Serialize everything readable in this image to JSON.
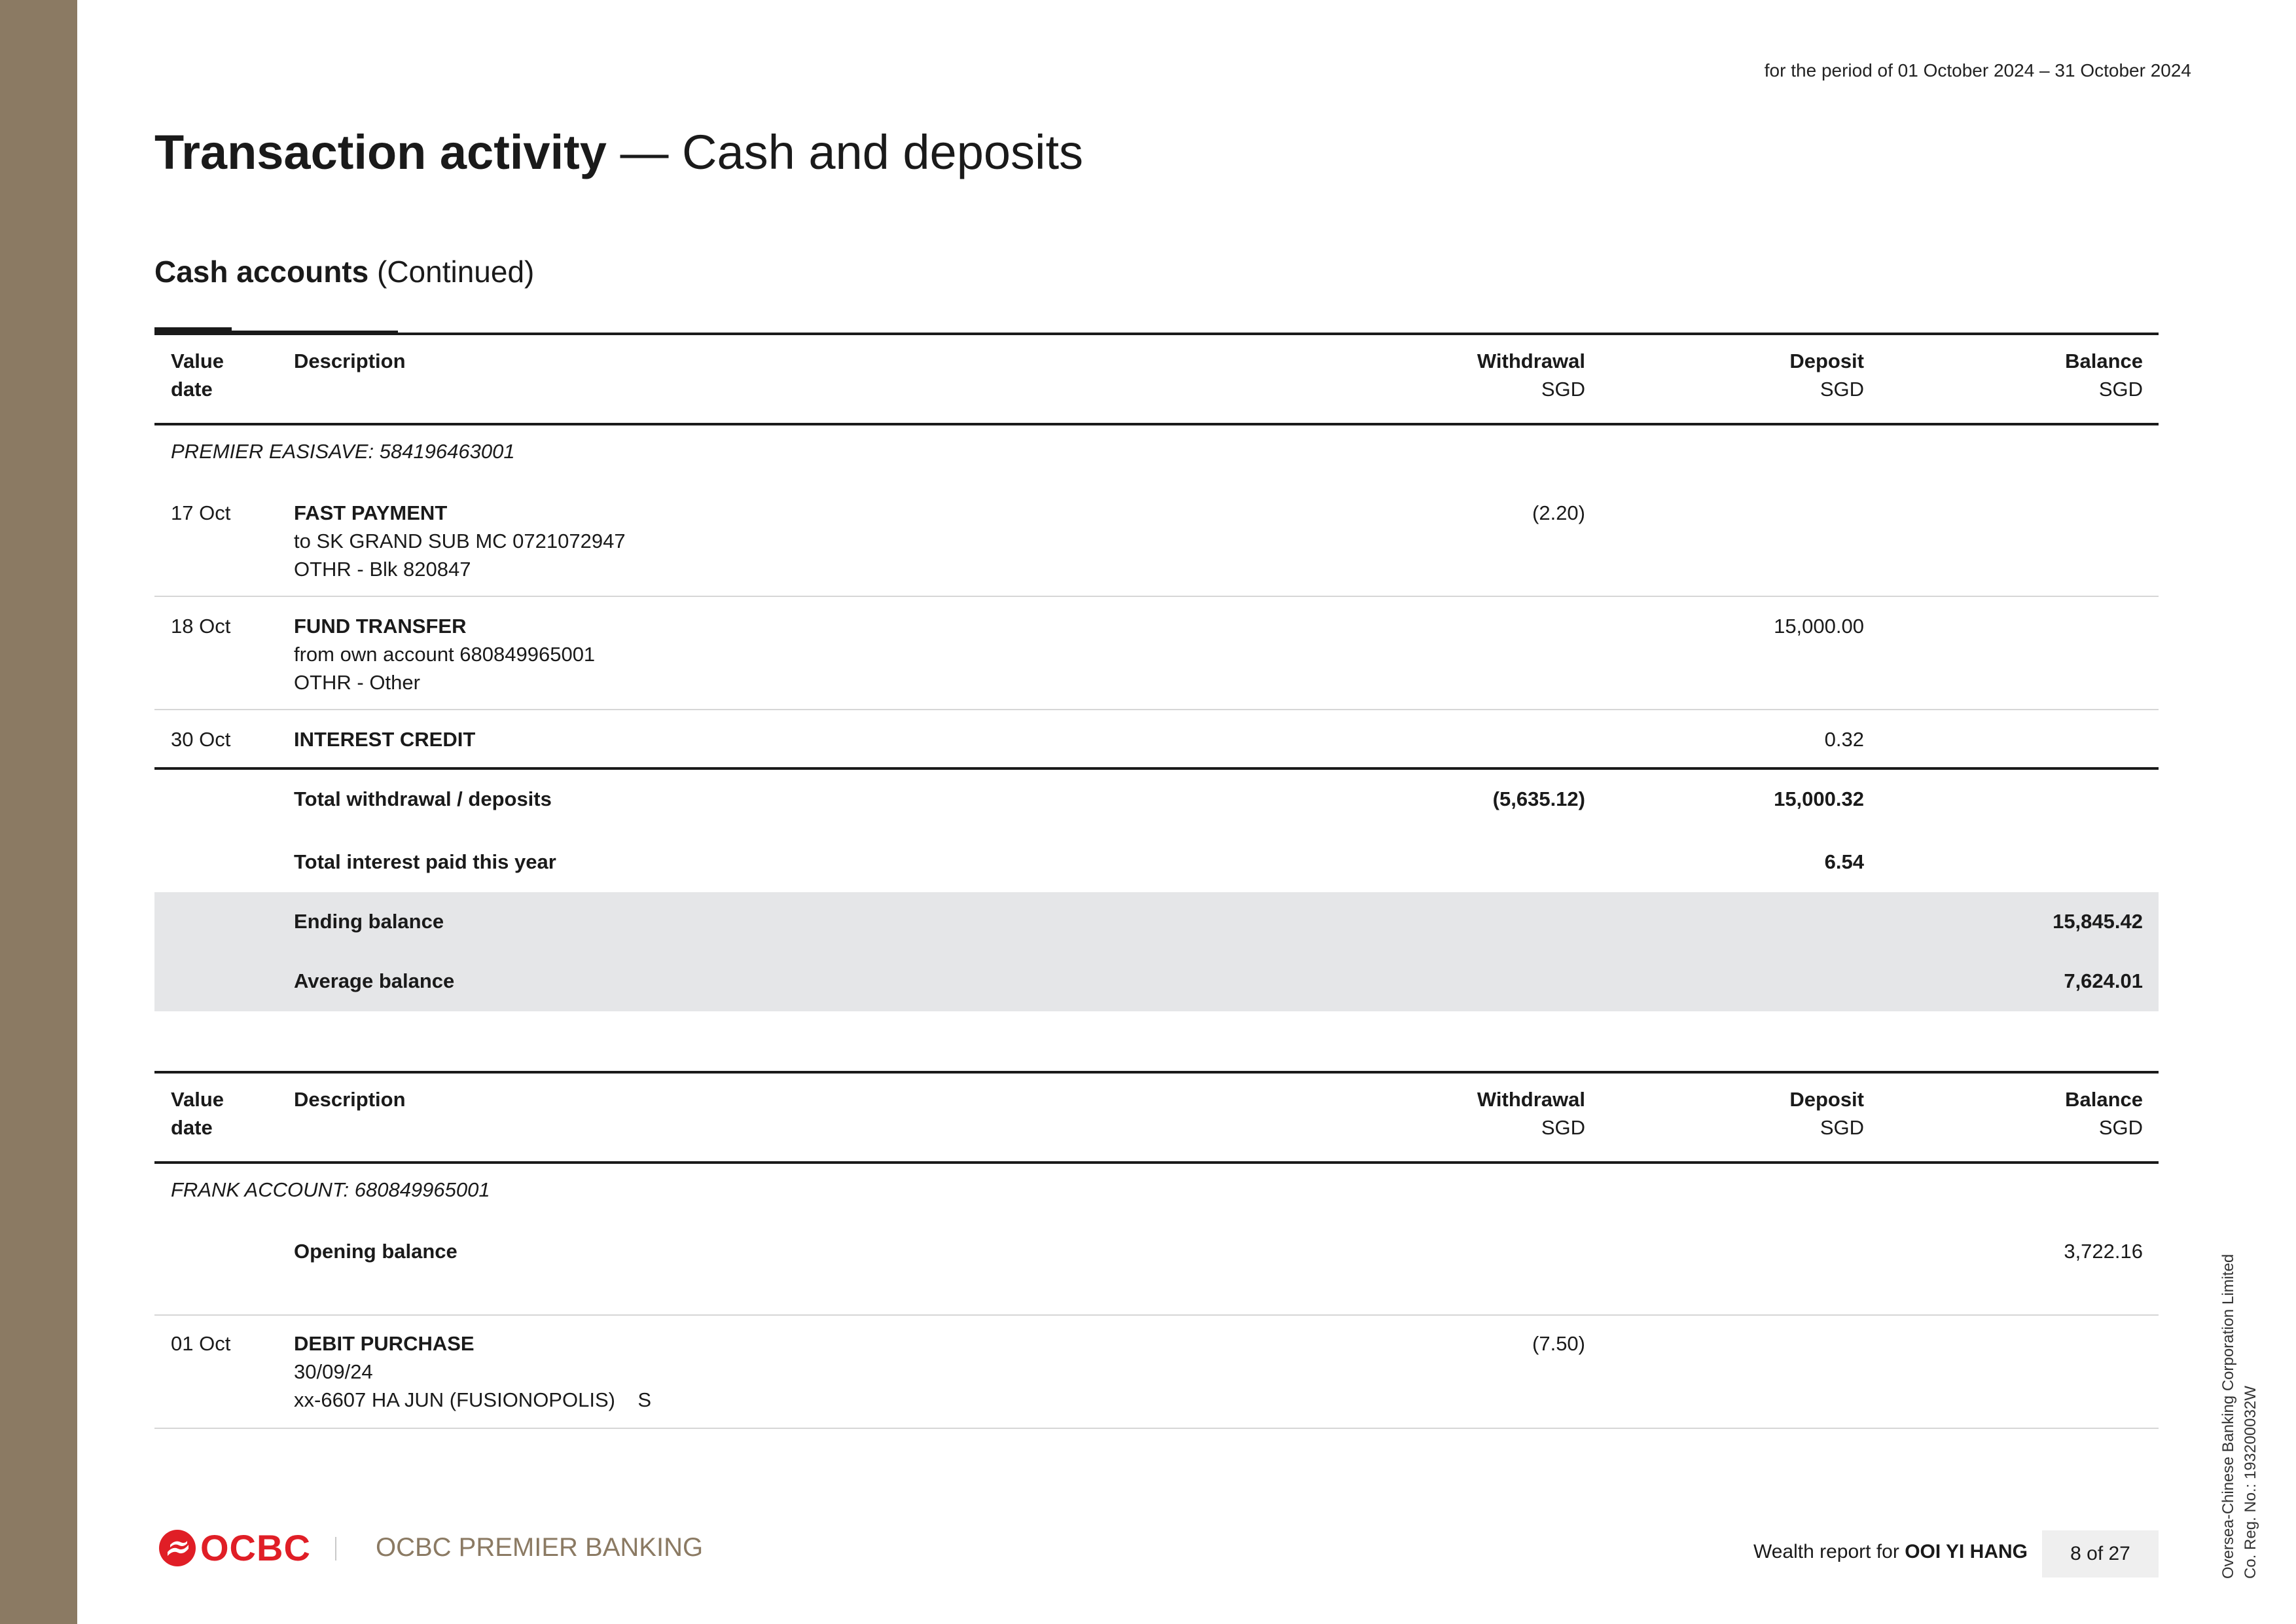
{
  "header": {
    "period": "for the period of 01 October 2024 – 31 October 2024",
    "title_bold": "Transaction activity",
    "title_rest": " — Cash and deposits",
    "section_bold": "Cash accounts",
    "section_rest": " (Continued)"
  },
  "columns": {
    "value_date_1": "Value",
    "value_date_2": "date",
    "description": "Description",
    "withdrawal": "Withdrawal",
    "deposit": "Deposit",
    "balance": "Balance",
    "unit": "SGD"
  },
  "table1": {
    "account": "PREMIER EASISAVE: 584196463001",
    "rows": [
      {
        "date": "17 Oct",
        "title": "FAST PAYMENT",
        "line2": "to SK GRAND SUB MC 0721072947",
        "line3": "OTHR - Blk 820847",
        "withdrawal": "(2.20)",
        "deposit": ""
      },
      {
        "date": "18 Oct",
        "title": "FUND TRANSFER",
        "line2": "from own account 680849965001",
        "line3": "OTHR - Other",
        "withdrawal": "",
        "deposit": "15,000.00"
      },
      {
        "date": "30 Oct",
        "title": "INTEREST CREDIT",
        "withdrawal": "",
        "deposit": "0.32"
      }
    ],
    "totals": {
      "total_label": "Total withdrawal / deposits",
      "total_withdrawal": "(5,635.12)",
      "total_deposit": "15,000.32",
      "interest_label": "Total interest paid this year",
      "interest_value": "6.54",
      "ending_label": "Ending balance",
      "ending_value": "15,845.42",
      "average_label": "Average balance",
      "average_value": "7,624.01"
    }
  },
  "table2": {
    "account": "FRANK ACCOUNT: 680849965001",
    "opening_label": "Opening balance",
    "opening_value": "3,722.16",
    "rows": [
      {
        "date": "01 Oct",
        "title": "DEBIT PURCHASE",
        "line2": "30/09/24",
        "line3": "xx-6607 HA JUN (FUSIONOPOLIS)    S",
        "withdrawal": "(7.50)"
      }
    ]
  },
  "footer": {
    "logo_text": "OCBC",
    "brand": "OCBC PREMIER BANKING",
    "wealth_prefix": "Wealth report for ",
    "client_name": "OOI YI HANG",
    "page": "8 of  27",
    "company_line1": "Oversea-Chinese Banking Corporation Limited",
    "company_line2": "Co. Reg. No.: 193200032W"
  },
  "colors": {
    "side_strip": "#8b7a63",
    "logo_red": "#e01e26",
    "shade": "#e5e6e8"
  }
}
